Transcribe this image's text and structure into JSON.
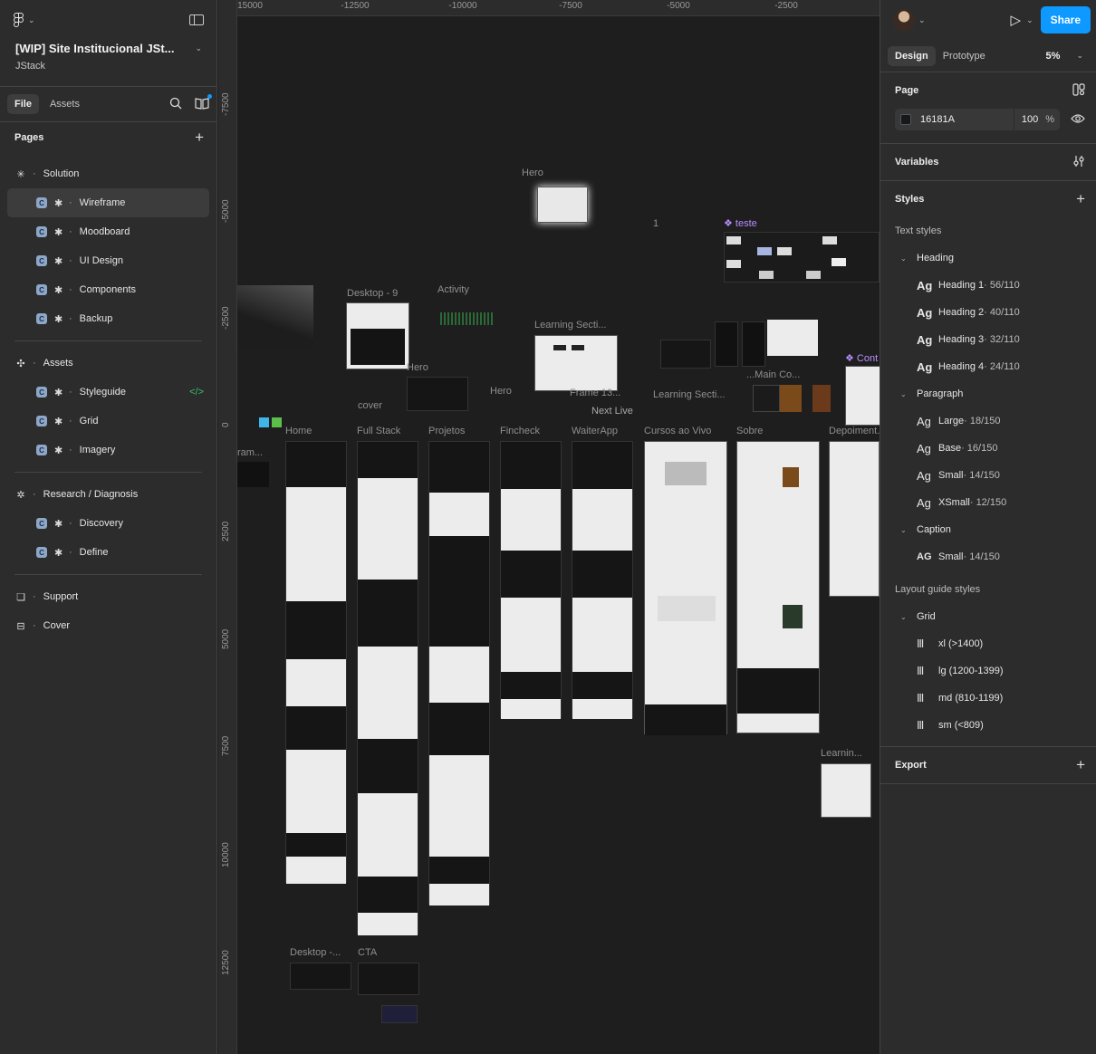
{
  "file": {
    "title": "[WIP] Site Institucional JSt...",
    "team": "JStack"
  },
  "left_tabs": {
    "file": "File",
    "assets": "Assets"
  },
  "pages_header": "Pages",
  "pages": [
    {
      "label": "Solution",
      "kind": "section"
    },
    {
      "label": "Wireframe",
      "kind": "child",
      "selected": true
    },
    {
      "label": "Moodboard",
      "kind": "child"
    },
    {
      "label": "UI Design",
      "kind": "child"
    },
    {
      "label": "Components",
      "kind": "child"
    },
    {
      "label": "Backup",
      "kind": "child"
    },
    {
      "label": "Assets",
      "kind": "section"
    },
    {
      "label": "Styleguide",
      "kind": "child",
      "dev": true
    },
    {
      "label": "Grid",
      "kind": "child"
    },
    {
      "label": "Imagery",
      "kind": "child"
    },
    {
      "label": "Research / Diagnosis",
      "kind": "section"
    },
    {
      "label": "Discovery",
      "kind": "child"
    },
    {
      "label": "Define",
      "kind": "child"
    },
    {
      "label": "Support",
      "kind": "plain"
    },
    {
      "label": "Cover",
      "kind": "plain"
    }
  ],
  "canvas": {
    "ruler_x": [
      "15000",
      "-12500",
      "-10000",
      "-7500",
      "-5000",
      "-2500"
    ],
    "ruler_y": [
      "-7500",
      "-5000",
      "-2500",
      "0",
      "2500",
      "5000",
      "7500",
      "10000",
      "12500"
    ],
    "frame_labels": {
      "hero_top": "Hero",
      "one": "1",
      "teste": "teste",
      "desktop9": "Desktop - 9",
      "activity": "Activity",
      "learning1": "Learning Secti...",
      "hero2": "Hero",
      "hero3": "Hero",
      "cover": "cover",
      "frame13": "Frame 13...",
      "next_live": "Next Live",
      "learning2": "Learning Secti...",
      "main_co": "...Main Co...",
      "cont": "Cont",
      "home": "Home",
      "fullstack": "Full Stack",
      "projetos": "Projetos",
      "fincheck": "Fincheck",
      "waiterapp": "WaiterApp",
      "cursos": "Cursos ao Vivo",
      "sobre": "Sobre",
      "depoimentos": "Depoiment...",
      "frame_left": "ram...",
      "learning3": "Learnin...",
      "desktop_bottom": "Desktop -...",
      "cta": "CTA"
    }
  },
  "right": {
    "share": "Share",
    "tabs": {
      "design": "Design",
      "prototype": "Prototype"
    },
    "zoom": "5%",
    "page": {
      "title": "Page",
      "color": "16181A",
      "opacity": "100",
      "percent": "%",
      "swatch": "#16181A"
    },
    "variables": "Variables",
    "styles": "Styles",
    "text_styles": "Text styles",
    "groups": {
      "heading": "Heading",
      "paragraph": "Paragraph",
      "caption": "Caption"
    },
    "heading_styles": [
      {
        "ag": "Ag",
        "name": "Heading 1",
        "meta": " · 56/110"
      },
      {
        "ag": "Ag",
        "name": "Heading 2",
        "meta": " · 40/110"
      },
      {
        "ag": "Ag",
        "name": "Heading 3",
        "meta": " · 32/110"
      },
      {
        "ag": "Ag",
        "name": "Heading 4",
        "meta": " · 24/110"
      }
    ],
    "paragraph_styles": [
      {
        "ag": "Ag",
        "name": "Large",
        "meta": " · 18/150"
      },
      {
        "ag": "Ag",
        "name": "Base",
        "meta": " · 16/150"
      },
      {
        "ag": "Ag",
        "name": "Small",
        "meta": " · 14/150"
      },
      {
        "ag": "Ag",
        "name": "XSmall",
        "meta": " · 12/150"
      }
    ],
    "caption_styles": [
      {
        "ag": "AG",
        "name": "Small",
        "meta": " · 14/150"
      }
    ],
    "layout_guides": "Layout guide styles",
    "grid_group": "Grid",
    "grid_styles": [
      "xl (>1400)",
      "lg (1200-1399)",
      "md (810-1199)",
      "sm (<809)"
    ],
    "export": "Export"
  }
}
